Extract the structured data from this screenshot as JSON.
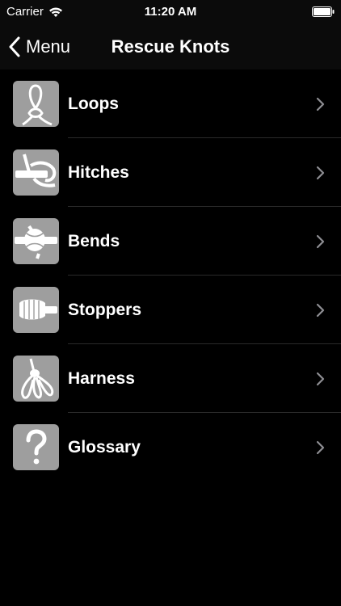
{
  "status_bar": {
    "carrier": "Carrier",
    "time": "11:20 AM"
  },
  "nav": {
    "back_label": "Menu",
    "title": "Rescue Knots"
  },
  "items": [
    {
      "label": "Loops",
      "icon": "loop-knot-icon"
    },
    {
      "label": "Hitches",
      "icon": "hitch-knot-icon"
    },
    {
      "label": "Bends",
      "icon": "bend-knot-icon"
    },
    {
      "label": "Stoppers",
      "icon": "stopper-knot-icon"
    },
    {
      "label": "Harness",
      "icon": "harness-knot-icon"
    },
    {
      "label": "Glossary",
      "icon": "question-mark-icon"
    }
  ],
  "colors": {
    "background": "#000000",
    "bar_background": "#0b0b0b",
    "thumbnail": "#9e9e9e",
    "chevron": "#8e8e93",
    "separator": "#2a2a2a"
  }
}
